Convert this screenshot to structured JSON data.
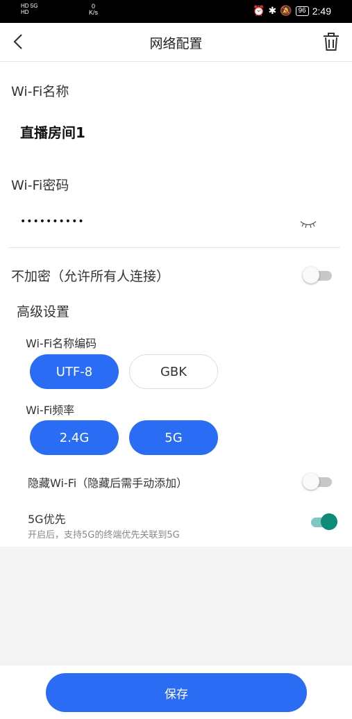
{
  "status_bar": {
    "sim1": "HD 5G",
    "sim2": "HD",
    "speed_value": "0",
    "speed_unit": "K/s",
    "battery": "96",
    "time": "2:49"
  },
  "header": {
    "title": "网络配置",
    "back_icon": "chevron-left-icon",
    "delete_icon": "trash-icon"
  },
  "form": {
    "ssid_label": "Wi-Fi名称",
    "ssid_value": "直播房间1",
    "password_label": "Wi-Fi密码",
    "password_value": "••••••••••",
    "password_visibility_icon": "eye-closed-icon",
    "open_network_label": "不加密（允许所有人连接）",
    "open_network_enabled": false
  },
  "advanced": {
    "title": "高级设置",
    "encoding_label": "Wi-Fi名称编码",
    "encoding_options": [
      "UTF-8",
      "GBK"
    ],
    "encoding_selected": "UTF-8",
    "frequency_label": "Wi-Fi频率",
    "frequency_options": [
      "2.4G",
      "5G"
    ],
    "frequency_selected": [
      "2.4G",
      "5G"
    ],
    "hide_wifi_label": "隐藏Wi-Fi（隐藏后需手动添加）",
    "hide_wifi_enabled": false,
    "prefer_5g_label": "5G优先",
    "prefer_5g_hint": "开启后，支持5G的终端优先关联到5G",
    "prefer_5g_enabled": true
  },
  "footer": {
    "save_label": "保存"
  },
  "colors": {
    "accent": "#2a6df4",
    "toggle_on": "#0d8a78"
  }
}
